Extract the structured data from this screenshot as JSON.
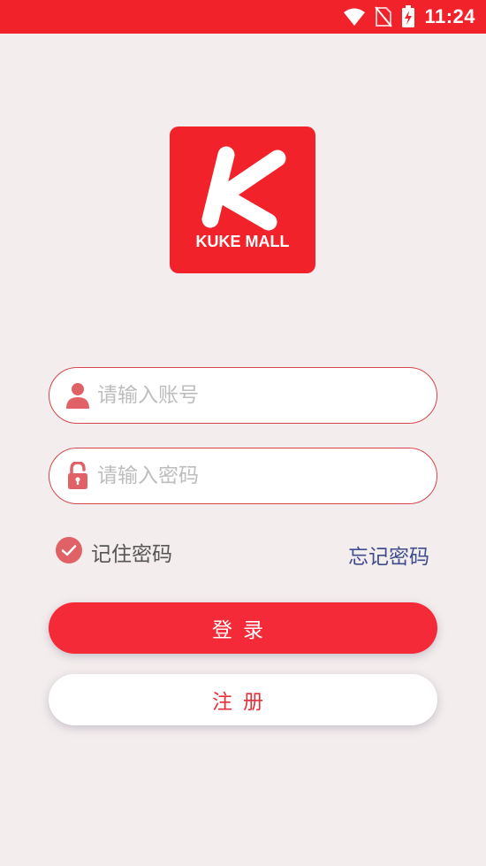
{
  "status_bar": {
    "time": "11:24",
    "wifi_icon": "wifi-icon",
    "signal_icon": "no-sim-icon",
    "battery_icon": "battery-charging-icon"
  },
  "logo": {
    "letter": "K",
    "text": "KUKE MALL",
    "color": "#f2222b"
  },
  "account_field": {
    "value": "",
    "placeholder": "请输入账号",
    "icon": "user-icon"
  },
  "password_field": {
    "value": "",
    "placeholder": "请输入密码",
    "icon": "lock-icon"
  },
  "remember": {
    "label": "记住密码",
    "checked": true
  },
  "forgot": {
    "label": "忘记密码"
  },
  "buttons": {
    "login_label": "登录",
    "register_label": "注册"
  },
  "colors": {
    "brand": "#f2222b",
    "login_button": "#f52a39",
    "link": "#3f4d8f",
    "background": "#f3eded"
  }
}
